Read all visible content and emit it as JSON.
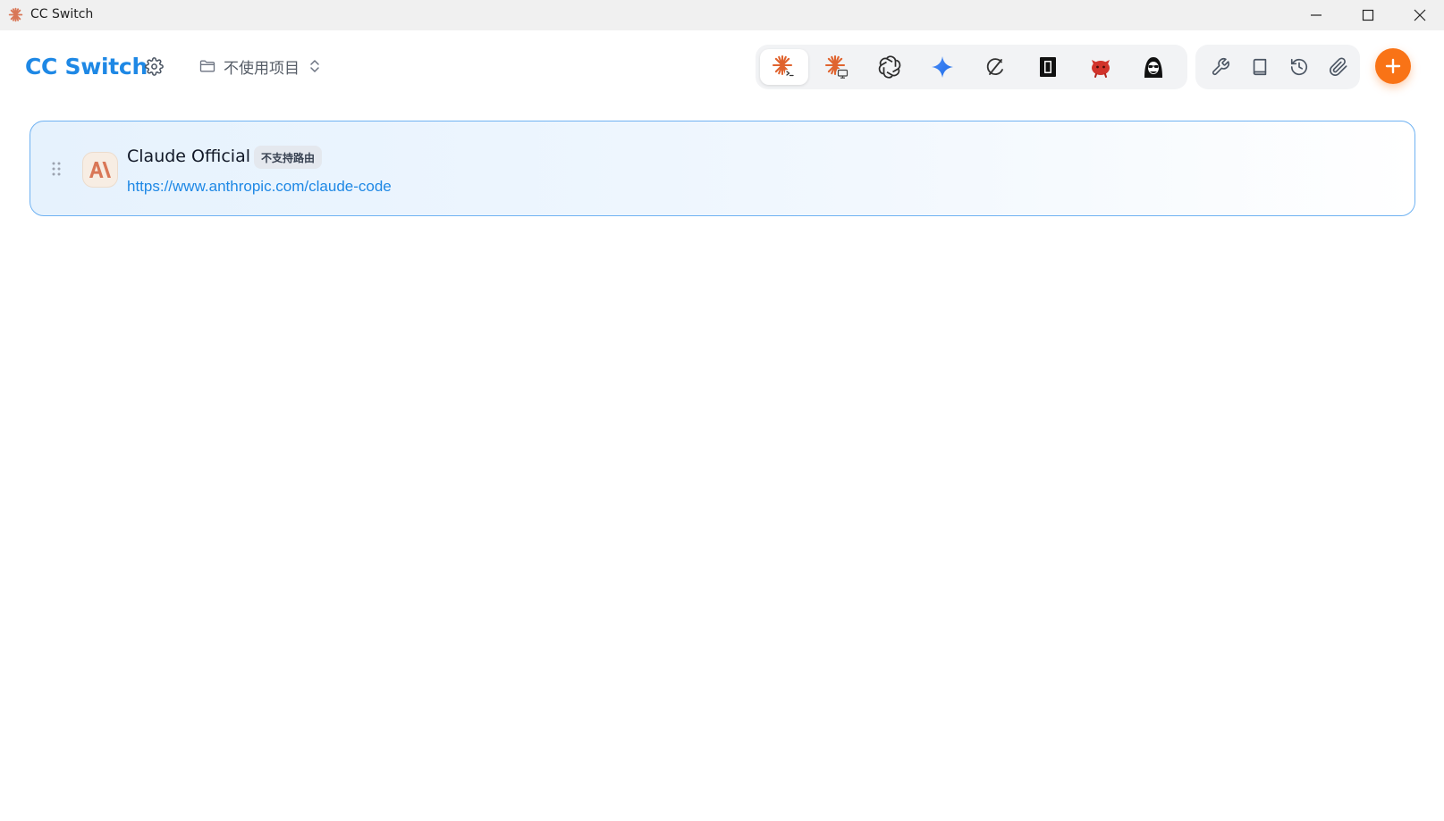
{
  "window": {
    "title": "CC Switch",
    "controls": [
      "minimize-icon",
      "maximize-icon",
      "close-icon"
    ]
  },
  "header": {
    "brand": "CC Switch",
    "project_label": "不使用项目",
    "app_tabs": [
      {
        "icon": "claude-code-icon",
        "active": true
      },
      {
        "icon": "claude-desktop-icon",
        "active": false
      },
      {
        "icon": "openai-codex-icon",
        "active": false
      },
      {
        "icon": "gemini-icon",
        "active": false
      },
      {
        "icon": "opencode-icon",
        "active": false
      },
      {
        "icon": "kiro-icon",
        "active": false
      },
      {
        "icon": "red-mascot-icon",
        "active": false
      },
      {
        "icon": "hacker-mascot-icon",
        "active": false
      }
    ],
    "utility_icons": [
      "wrench-icon",
      "book-icon",
      "history-icon",
      "paperclip-icon"
    ],
    "add_icon": "plus-icon"
  },
  "providers": [
    {
      "name": "Claude Official",
      "badge": "不支持路由",
      "url": "https://www.anthropic.com/claude-code",
      "logo_icon": "anthropic-logo-icon",
      "selected": true
    }
  ],
  "colors": {
    "brand": "#1e88e5",
    "accent": "#f97316",
    "card_border": "#6fb2f2",
    "card_bg": "#e6f2fd",
    "claude_orange": "#d97757"
  }
}
